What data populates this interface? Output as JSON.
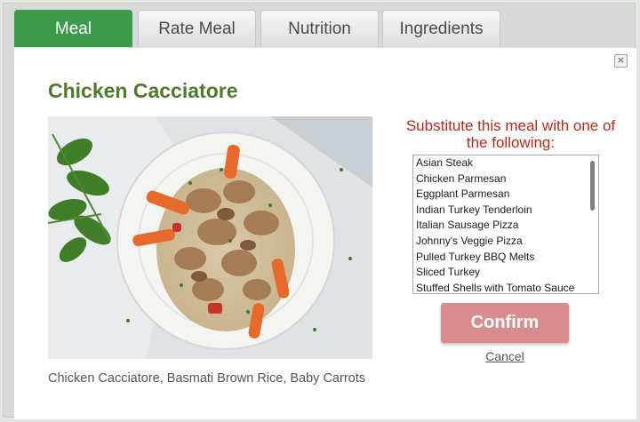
{
  "tabs": [
    {
      "label": "Meal",
      "active": true
    },
    {
      "label": "Rate Meal",
      "active": false
    },
    {
      "label": "Nutrition",
      "active": false
    },
    {
      "label": "Ingredients",
      "active": false
    }
  ],
  "dialog": {
    "close_symbol": "×",
    "title": "Chicken Cacciatore",
    "photo_icon": "meal-photo",
    "caption": "Chicken Cacciatore, Basmati Brown Rice, Baby Carrots"
  },
  "substitute": {
    "heading": "Substitute this meal with one of the following:",
    "options": [
      "Asian Steak",
      "Chicken Parmesan",
      "Eggplant Parmesan",
      "Indian Turkey Tenderloin",
      "Italian Sausage Pizza",
      "Johnny's Veggie Pizza",
      "Pulled Turkey BBQ Melts",
      "Sliced Turkey",
      "Stuffed Shells with Tomato Sauce"
    ],
    "confirm_label": "Confirm",
    "cancel_label": "Cancel"
  },
  "colors": {
    "active_tab": "#3d9a4a",
    "title_green": "#4f7a2c",
    "heading_red": "#b22a1c",
    "confirm_button": "#d88c8e"
  }
}
